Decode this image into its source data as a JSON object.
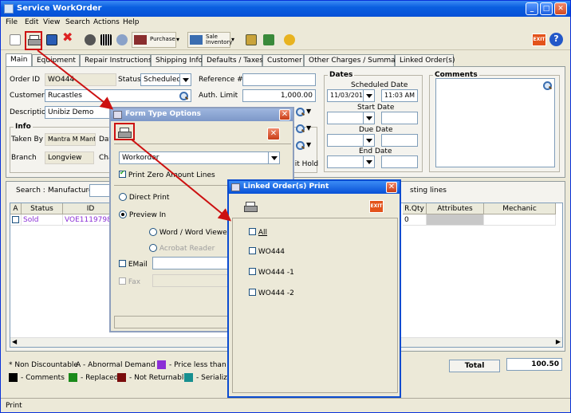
{
  "window": {
    "title": "Service WorkOrder"
  },
  "menu": [
    "File",
    "Edit",
    "View",
    "Search",
    "Actions",
    "Help"
  ],
  "toolbar": {
    "purchase_label": "Purchase",
    "sale_label_1": "Sale",
    "sale_label_2": "Inventory",
    "exit_label": "EXIT"
  },
  "tabs": [
    "Main",
    "Equipment",
    "Repair Instructions",
    "Shipping Info",
    "Defaults / Taxes",
    "Customer",
    "Other Charges / Summary",
    "Linked Order(s)"
  ],
  "form": {
    "order_id_label": "Order ID",
    "order_id": "WO444",
    "status_label": "Status",
    "status": "Scheduled",
    "ref_label": "Reference #",
    "ref": "",
    "customer_label": "Customer",
    "customer": "Rucastles",
    "auth_label": "Auth. Limit",
    "auth": "1,000.00",
    "desc_label": "Description",
    "desc": "Unibiz Demo",
    "info_label": "Info",
    "taken_by_label": "Taken By",
    "taken_by": "Mantra M Mantra",
    "date_fragment": "Dat",
    "branch_label": "Branch",
    "branch": "Longview",
    "cha_fragment": "Cha",
    "hold_fragment": "dit Hold",
    "dates_label": "Dates",
    "scheduled_label": "Scheduled Date",
    "scheduled_date": "11/03/2011",
    "scheduled_time": "11:03 AM",
    "start_label": "Start Date",
    "due_label": "Due Date",
    "end_label": "End Date",
    "comments_label": "Comments"
  },
  "grid": {
    "search_label": "Search :",
    "manufacturer_label": "Manufacturer",
    "existing_fragment": "sting lines",
    "columns": [
      "A",
      "Status",
      "ID",
      "R.Qty",
      "Attributes",
      "Mechanic"
    ],
    "row": {
      "status": "Sold",
      "id": "VOE1119798",
      "rqty_fragment": "0"
    }
  },
  "legend": {
    "non_disc": "* Non Discountable",
    "abnormal": "A - Abnormal Demand",
    "price_less": "- Price less than Co",
    "comments": "- Comments",
    "replaced": "- Replaced",
    "not_returnable": "- Not Returnable",
    "serialized": "- Serialized",
    "total_label": "Total",
    "total_value": "100.50"
  },
  "status_bar": "Print",
  "form_type_dialog": {
    "title": "Form Type Options",
    "form_select": "Workorder",
    "print_zero": "Print Zero Amount Lines",
    "direct_print": "Direct Print",
    "preview_in": "Preview In",
    "word_viewer": "Word / Word Viewer",
    "acrobat": "Acrobat Reader",
    "email": "EMail",
    "fax": "Fax"
  },
  "linked_dialog": {
    "title": "Linked Order(s) Print",
    "exit_label": "EXIT",
    "items": [
      "All",
      "WO444",
      "WO444 -1",
      "WO444 -2"
    ]
  },
  "colors": {
    "title_blue": "#0750d6",
    "red_arrow": "#cc1111",
    "purple": "#8b2fd6",
    "green": "#1a8a1a",
    "maroon": "#7a0c0c",
    "teal": "#178f8f"
  }
}
